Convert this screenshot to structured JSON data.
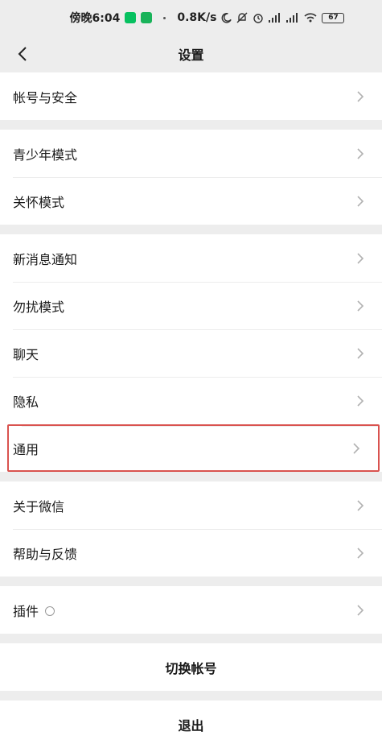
{
  "status_bar": {
    "time": "傍晚6:04",
    "network_speed": "0.8K/s",
    "battery": "67",
    "icons": [
      "wechat-notification-icon",
      "app-icon",
      "moon-icon",
      "mute-bell-icon",
      "alarm-icon",
      "signal-icon",
      "signal-icon",
      "wifi-icon",
      "battery-icon"
    ]
  },
  "nav": {
    "title": "设置",
    "back_icon": "chevron-left-icon"
  },
  "groups": [
    {
      "items": [
        {
          "label": "帐号与安全"
        }
      ]
    },
    {
      "items": [
        {
          "label": "青少年模式"
        },
        {
          "label": "关怀模式"
        }
      ]
    },
    {
      "items": [
        {
          "label": "新消息通知"
        },
        {
          "label": "勿扰模式"
        },
        {
          "label": "聊天"
        },
        {
          "label": "隐私"
        },
        {
          "label": "通用",
          "highlighted": true
        }
      ]
    },
    {
      "items": [
        {
          "label": "关于微信"
        },
        {
          "label": "帮助与反馈"
        }
      ]
    },
    {
      "items": [
        {
          "label": "插件",
          "badge_icon": "plugin-badge-icon"
        }
      ]
    }
  ],
  "actions": {
    "switch_account": "切换帐号",
    "logout": "退出"
  },
  "colors": {
    "background": "#ededed",
    "highlight_border": "#d9534f",
    "wechat_green": "#07c160"
  }
}
